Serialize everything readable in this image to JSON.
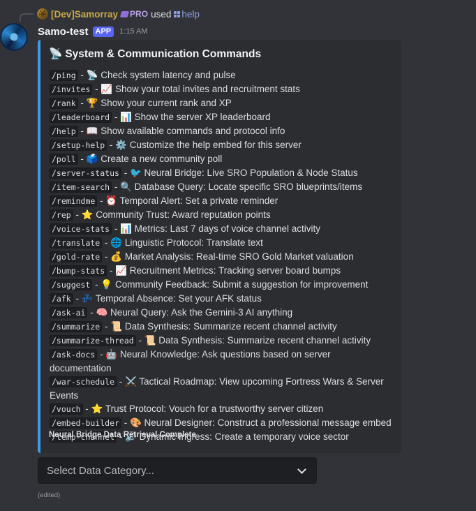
{
  "reply": {
    "avatar_glyph": "🏵",
    "username": "[Dev]Samorray",
    "tag": "PRO",
    "used": "used",
    "command": "help"
  },
  "message": {
    "bot_name": "Samo-test",
    "badge": "APP",
    "timestamp": "1:15 AM",
    "edited": "(edited)"
  },
  "embed": {
    "accent_color": "#3b9ee8",
    "title_emoji": "📡",
    "title": "System & Communication Commands",
    "commands": [
      {
        "cmd": "/ping",
        "emoji": "📡",
        "desc": "Check system latency and pulse"
      },
      {
        "cmd": "/invites",
        "emoji": "📈",
        "desc": "Show your total invites and recruitment stats"
      },
      {
        "cmd": "/rank",
        "emoji": "🏆",
        "desc": "Show your current rank and XP"
      },
      {
        "cmd": "/leaderboard",
        "emoji": "📊",
        "desc": "Show the server XP leaderboard"
      },
      {
        "cmd": "/help",
        "emoji": "📖",
        "desc": "Show available commands and protocol info"
      },
      {
        "cmd": "/setup-help",
        "emoji": "⚙️",
        "desc": "Customize the help embed for this server"
      },
      {
        "cmd": "/poll",
        "emoji": "🗳️",
        "desc": "Create a new community poll"
      },
      {
        "cmd": "/server-status",
        "emoji": "🐦",
        "desc": "Neural Bridge: Live SRO Population & Node Status"
      },
      {
        "cmd": "/item-search",
        "emoji": "🔍",
        "desc": "Database Query: Locate specific SRO blueprints/items"
      },
      {
        "cmd": "/remindme",
        "emoji": "⏰",
        "desc": "Temporal Alert: Set a private reminder"
      },
      {
        "cmd": "/rep",
        "emoji": "⭐",
        "desc": "Community Trust: Award reputation points"
      },
      {
        "cmd": "/voice-stats",
        "emoji": "📊",
        "desc": "Metrics: Last 7 days of voice channel activity"
      },
      {
        "cmd": "/translate",
        "emoji": "🌐",
        "desc": "Linguistic Protocol: Translate text"
      },
      {
        "cmd": "/gold-rate",
        "emoji": "💰",
        "desc": "Market Analysis: Real-time SRO Gold Market valuation"
      },
      {
        "cmd": "/bump-stats",
        "emoji": "📈",
        "desc": "Recruitment Metrics: Tracking server board bumps"
      },
      {
        "cmd": "/suggest",
        "emoji": "💡",
        "desc": "Community Feedback: Submit a suggestion for improvement"
      },
      {
        "cmd": "/afk",
        "emoji": "💤",
        "desc": "Temporal Absence: Set your AFK status"
      },
      {
        "cmd": "/ask-ai",
        "emoji": "🧠",
        "desc": "Neural Query: Ask the Gemini-3 AI anything"
      },
      {
        "cmd": "/summarize",
        "emoji": "📜",
        "desc": "Data Synthesis: Summarize recent channel activity"
      },
      {
        "cmd": "/summarize-thread",
        "emoji": "📜",
        "desc": "Data Synthesis: Summarize recent channel activity"
      },
      {
        "cmd": "/ask-docs",
        "emoji": "🤖",
        "desc": "Neural Knowledge: Ask questions based on server documentation"
      },
      {
        "cmd": "/war-schedule",
        "emoji": "⚔️",
        "desc": "Tactical Roadmap: View upcoming Fortress Wars & Server Events"
      },
      {
        "cmd": "/vouch",
        "emoji": "⭐",
        "desc": "Trust Protocol: Vouch for a trustworthy server citizen"
      },
      {
        "cmd": "/embed-builder",
        "emoji": "🎨",
        "desc": "Neural Designer: Construct a professional message embed"
      },
      {
        "cmd": "/temp-channel",
        "emoji": "🔊",
        "desc": "Dynamic Ingress: Create a temporary voice sector"
      }
    ],
    "footer": "Neural Bridge Data Retrieval Complete"
  },
  "select": {
    "placeholder": "Select Data Category..."
  }
}
